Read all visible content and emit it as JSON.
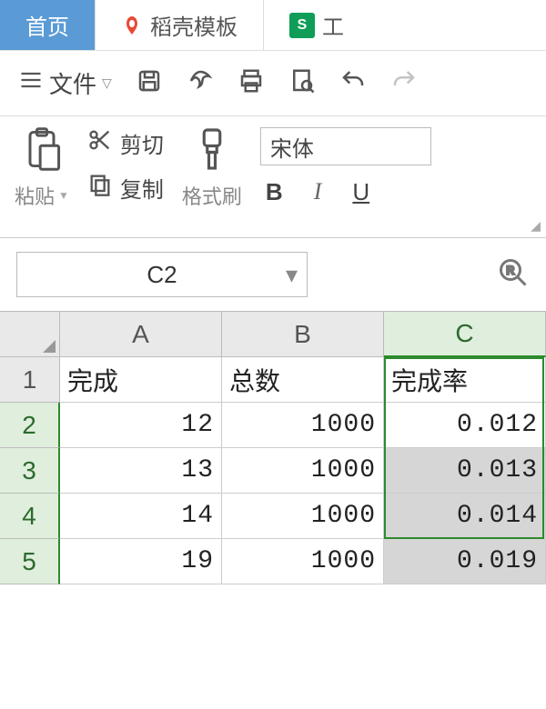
{
  "tabs": {
    "home": "首页",
    "docer": "稻壳模板",
    "sheet_partial": "工"
  },
  "menu": {
    "file": "文件"
  },
  "ribbon": {
    "paste": "粘贴",
    "cut": "剪切",
    "copy": "复制",
    "format_painter": "格式刷",
    "font_name": "宋体",
    "bold": "B",
    "italic": "I",
    "underline": "U"
  },
  "name_box": {
    "value": "C2"
  },
  "grid": {
    "cols": [
      "A",
      "B",
      "C"
    ],
    "row_hdrs": [
      "1",
      "2",
      "3",
      "4",
      "5"
    ],
    "headers": {
      "A": "完成",
      "B": "总数",
      "C": "完成率"
    },
    "rows": [
      {
        "A": "12",
        "B": "1000",
        "C": "0.012"
      },
      {
        "A": "13",
        "B": "1000",
        "C": "0.013"
      },
      {
        "A": "14",
        "B": "1000",
        "C": "0.014"
      },
      {
        "A": "19",
        "B": "1000",
        "C": "0.019"
      }
    ],
    "selected_col": "C",
    "active_cell": "C2"
  }
}
